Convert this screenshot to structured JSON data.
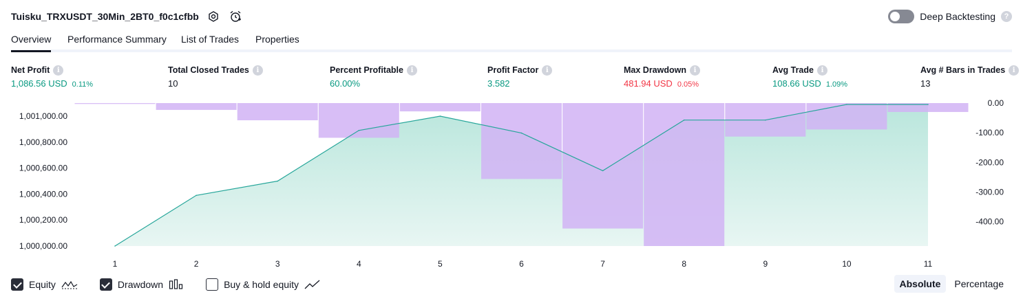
{
  "header": {
    "strategy_name": "Tuisku_TRXUSDT_30Min_2BT0_f0c1cfbb",
    "settings_icon": "gear-icon",
    "alert_icon": "alarm-clock-icon",
    "deep_backtesting_label": "Deep Backtesting",
    "deep_backtesting_enabled": false
  },
  "tabs": [
    {
      "label": "Overview",
      "active": true
    },
    {
      "label": "Performance Summary",
      "active": false
    },
    {
      "label": "List of Trades",
      "active": false
    },
    {
      "label": "Properties",
      "active": false
    }
  ],
  "stats": {
    "net_profit": {
      "label": "Net Profit",
      "value": "1,086.56 USD",
      "sub": "0.11%"
    },
    "total_closed_trades": {
      "label": "Total Closed Trades",
      "value": "10"
    },
    "percent_profitable": {
      "label": "Percent Profitable",
      "value": "60.00%"
    },
    "profit_factor": {
      "label": "Profit Factor",
      "value": "3.582"
    },
    "max_drawdown": {
      "label": "Max Drawdown",
      "value": "481.94 USD",
      "sub": "0.05%"
    },
    "avg_trade": {
      "label": "Avg Trade",
      "value": "108.66 USD",
      "sub": "1.09%"
    },
    "avg_bars": {
      "label": "Avg # Bars in Trades",
      "value": "13"
    }
  },
  "colors": {
    "equity_line": "#26a69a",
    "equity_fill": "#c8eae2",
    "drawdown_bar": "#d1b3f5",
    "positive": "#089981",
    "negative": "#f23645"
  },
  "chart_data": {
    "type": "line",
    "x": [
      "1",
      "2",
      "3",
      "4",
      "5",
      "6",
      "7",
      "8",
      "9",
      "10",
      "11"
    ],
    "series": [
      {
        "name": "Equity",
        "type": "area",
        "axis": "left",
        "values": [
          1000000,
          1000390,
          1000500,
          1000890,
          1001000,
          1000870,
          1000580,
          1000970,
          1000970,
          1001090,
          1001090
        ]
      },
      {
        "name": "Drawdown",
        "type": "bar",
        "axis": "right",
        "values": [
          -3,
          -23,
          -58,
          -117,
          -28,
          -256,
          -423,
          -482,
          -113,
          -89,
          -30
        ]
      }
    ],
    "y_left_ticks": [
      "1,001,000.00",
      "1,000,800.00",
      "1,000,600.00",
      "1,000,400.00",
      "1,000,200.00",
      "1,000,000.00"
    ],
    "y_left_range": [
      1000000,
      1001090
    ],
    "y_right_ticks": [
      "0.00",
      "-100.00",
      "-200.00",
      "-300.00",
      "-400.00"
    ],
    "y_right_range": [
      -482,
      0
    ]
  },
  "legend": [
    {
      "label": "Equity",
      "checked": true,
      "icon": "equity-wave-icon"
    },
    {
      "label": "Drawdown",
      "checked": true,
      "icon": "drawdown-bars-icon"
    },
    {
      "label": "Buy & hold equity",
      "checked": false,
      "icon": "buy-hold-line-icon"
    }
  ],
  "mode": {
    "absolute_label": "Absolute",
    "percentage_label": "Percentage",
    "selected": "Absolute"
  }
}
